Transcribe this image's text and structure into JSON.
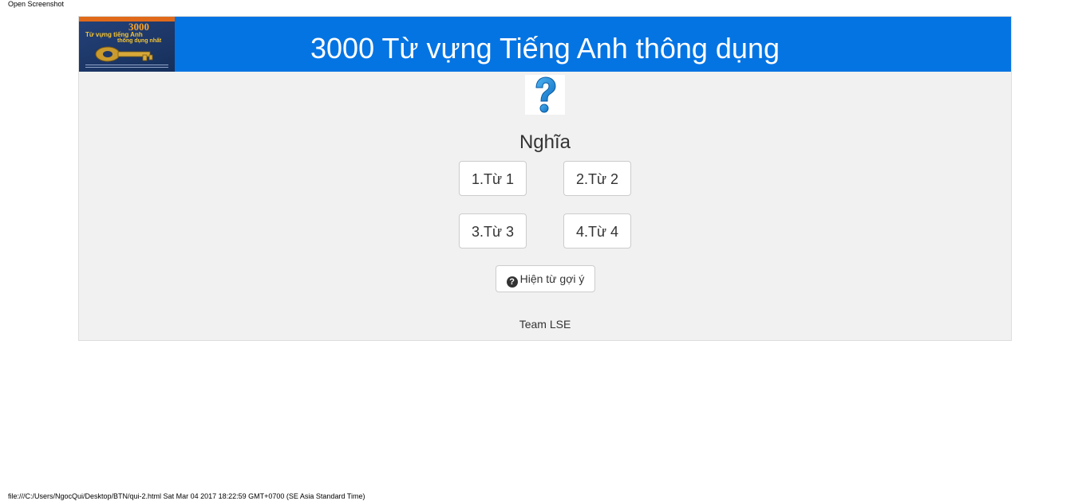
{
  "print": {
    "header": "Open Screenshot",
    "footer": "file:///C:/Users/NgocQui/Desktop/BTN/qui-2.html Sat Mar 04 2017 18:22:59 GMT+0700 (SE Asia Standard Time)"
  },
  "banner": {
    "title": "3000 Từ vựng Tiếng Anh thông dụng",
    "background": "#0474e3",
    "book_cover": {
      "number": "3000",
      "line1": "Từ vựng tiếng Anh",
      "line2": "thông dụng nhất"
    }
  },
  "question": {
    "icon": "question-mark-icon",
    "meaning": "Nghĩa"
  },
  "answers": [
    {
      "label": "1.Từ 1"
    },
    {
      "label": "2.Từ 2"
    },
    {
      "label": "3.Từ 3"
    },
    {
      "label": "4.Từ 4"
    }
  ],
  "hint": {
    "icon": "question-circle-icon",
    "label": "Hiện từ gợi ý"
  },
  "footer": {
    "team": "Team LSE"
  }
}
